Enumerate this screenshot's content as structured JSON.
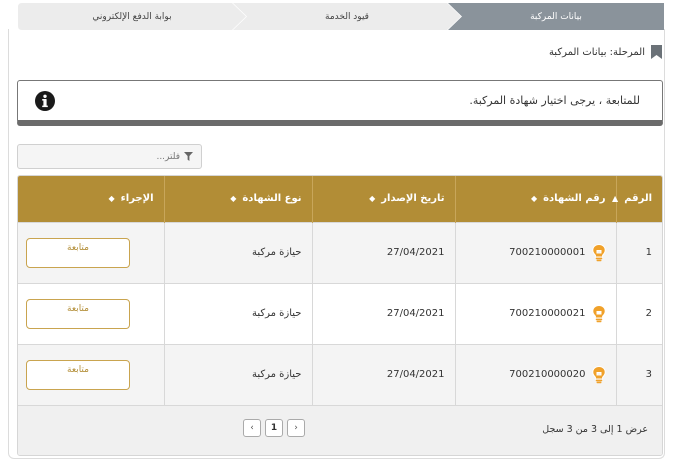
{
  "steps": [
    {
      "label": "بيانات المركبة",
      "state": "active"
    },
    {
      "label": "قيود الخدمة",
      "state": "inactive"
    },
    {
      "label": "بوابة الدفع الإلكتروني",
      "state": "inactive"
    }
  ],
  "stage": {
    "label": "المرحلة: بيانات المركبة"
  },
  "info": {
    "message": "للمتابعة ، يرجى اختيار شهادة المركبة."
  },
  "filter": {
    "placeholder": "فلتر..."
  },
  "table": {
    "headers": {
      "index": "الرقم",
      "certificate_no": "رقم الشهادة",
      "issue_date": "تاريخ الإصدار",
      "certificate_type": "نوع الشهادة",
      "action": "الإجراء"
    },
    "rows": [
      {
        "index": "1",
        "certificate_no": "700210000001",
        "issue_date": "27/04/2021",
        "certificate_type": "حيازة مركبة",
        "action": "متابعة"
      },
      {
        "index": "2",
        "certificate_no": "700210000021",
        "issue_date": "27/04/2021",
        "certificate_type": "حيازة مركبة",
        "action": "متابعة"
      },
      {
        "index": "3",
        "certificate_no": "700210000020",
        "issue_date": "27/04/2021",
        "certificate_type": "حيازة مركبة",
        "action": "متابعة"
      }
    ]
  },
  "footer": {
    "summary": "عرض 1 إلى 3 من 3 سجل",
    "current_page": "1"
  },
  "colors": {
    "accent": "#b28d36",
    "step_active": "#8a939b",
    "step_inactive": "#ececec",
    "bulb": "#f0a12a"
  }
}
